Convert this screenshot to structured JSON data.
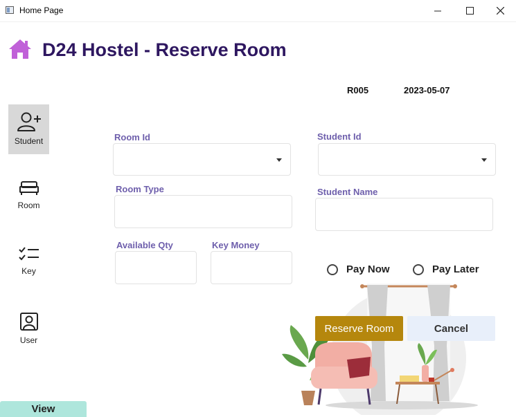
{
  "window": {
    "title": "Home Page",
    "minimize": "—",
    "maximize": "☐",
    "close": "✕"
  },
  "header": {
    "title": "D24 Hostel - Reserve Room",
    "icon": "home-icon",
    "icon_color": "#c061d8"
  },
  "reservation": {
    "id": "R005",
    "date": "2023-05-07"
  },
  "nav": [
    {
      "label": "Student",
      "icon": "add-user-icon",
      "active": true
    },
    {
      "label": "Room",
      "icon": "bed-icon"
    },
    {
      "label": "Key",
      "icon": "checklist-icon"
    },
    {
      "label": "User",
      "icon": "user-icon"
    }
  ],
  "form": {
    "room_id": {
      "label": "Room Id",
      "value": ""
    },
    "room_type": {
      "label": "Room Type",
      "value": ""
    },
    "available_qty": {
      "label": "Available Qty",
      "value": ""
    },
    "key_money": {
      "label": "Key Money",
      "value": ""
    },
    "student_id": {
      "label": "Student Id",
      "value": ""
    },
    "student_name": {
      "label": "Student Name",
      "value": ""
    }
  },
  "payment": {
    "pay_now": "Pay Now",
    "pay_later": "Pay Later"
  },
  "buttons": {
    "reserve": "Reserve Room",
    "cancel": "Cancel",
    "view": "View"
  },
  "colors": {
    "label": "#6e5fac",
    "title": "#2e1760",
    "reserve_button": "#b5870d",
    "cancel_button": "#e8effa",
    "view_button": "#aee6dc"
  }
}
